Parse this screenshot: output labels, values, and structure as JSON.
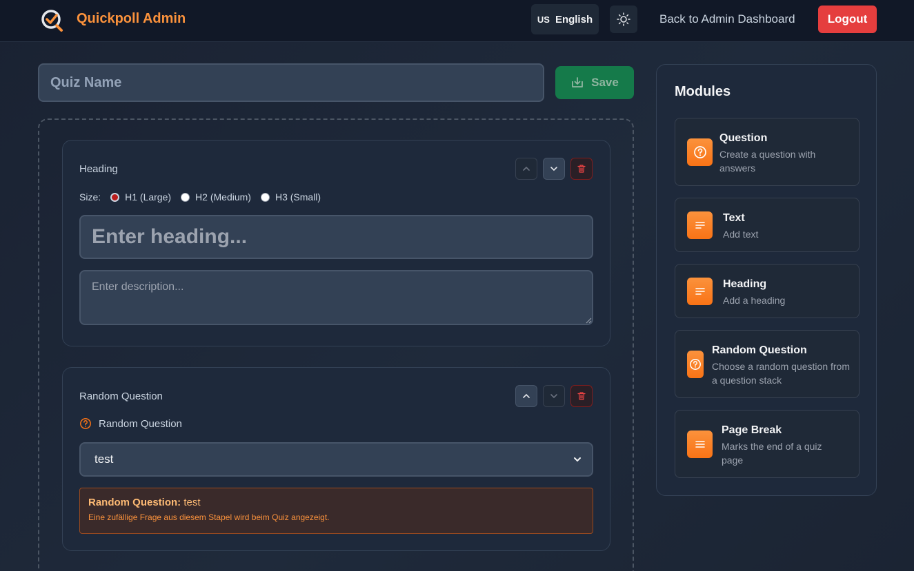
{
  "header": {
    "brand": "Quickpoll Admin",
    "language_flag": "US",
    "language_label": "English",
    "back_link": "Back to Admin Dashboard",
    "logout_label": "Logout"
  },
  "quiz": {
    "name_placeholder": "Quiz Name",
    "save_label": "Save"
  },
  "heading_card": {
    "title": "Heading",
    "size_label": "Size:",
    "size_options": [
      "H1 (Large)",
      "H2 (Medium)",
      "H3 (Small)"
    ],
    "selected_size": "H1 (Large)",
    "heading_placeholder": "Enter heading...",
    "description_placeholder": "Enter description..."
  },
  "random_card": {
    "title": "Random Question",
    "field_label": "Random Question",
    "selected_stack": "test",
    "info_label": "Random Question:",
    "info_value": "test",
    "info_note": "Eine zufällige Frage aus diesem Stapel wird beim Quiz angezeigt."
  },
  "modules": {
    "title": "Modules",
    "items": [
      {
        "title": "Question",
        "description": "Create a question with answers",
        "icon": "question-circle-icon"
      },
      {
        "title": "Text",
        "description": "Add text",
        "icon": "text-lines-icon"
      },
      {
        "title": "Heading",
        "description": "Add a heading",
        "icon": "text-lines-icon"
      },
      {
        "title": "Random Question",
        "description": "Choose a random question from a question stack",
        "icon": "question-circle-icon"
      },
      {
        "title": "Page Break",
        "description": "Marks the end of a quiz page",
        "icon": "menu-lines-icon"
      }
    ]
  },
  "colors": {
    "accent": "#fb923c",
    "logout": "#e53e3e",
    "save": "#157a4a",
    "background": "#1e293b"
  }
}
